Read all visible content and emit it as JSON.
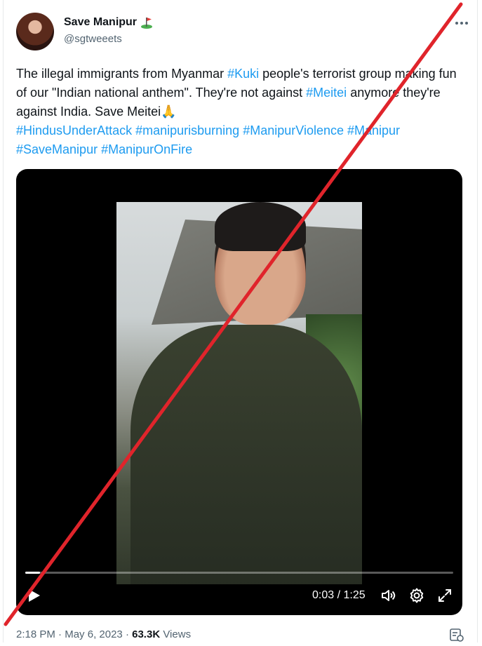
{
  "author": {
    "display_name": "Save Manipur",
    "handle": "@sgtweeets"
  },
  "tweet": {
    "t1": "The illegal immigrants from Myanmar ",
    "h1": "#Kuki",
    "t2": " people's terrorist group making fun of our \"Indian national anthem\". They're not against ",
    "h2": "#Meitei",
    "t3": " anymore they're against India. Save Meitei🙏",
    "h3": "#HindusUnderAttack",
    "h4": "#manipurisburning",
    "h5": "#ManipurViolence",
    "h6": "#Manipur",
    "h7": "#SaveManipur",
    "h8": "#ManipurOnFire"
  },
  "video": {
    "time": "0:03 / 1:25",
    "progress": 0.035
  },
  "meta": {
    "time": "2:18 PM",
    "sep1": " · ",
    "date": "May 6, 2023",
    "sep2": " · ",
    "views_count": "63.3K",
    "views_label": " Views"
  },
  "colors": {
    "accent": "#1d9bf0",
    "strike": "#e0242b"
  },
  "icons": [
    "flag-icon",
    "more-icon",
    "play-icon",
    "volume-icon",
    "gear-icon",
    "fullscreen-icon",
    "analytics-icon"
  ]
}
